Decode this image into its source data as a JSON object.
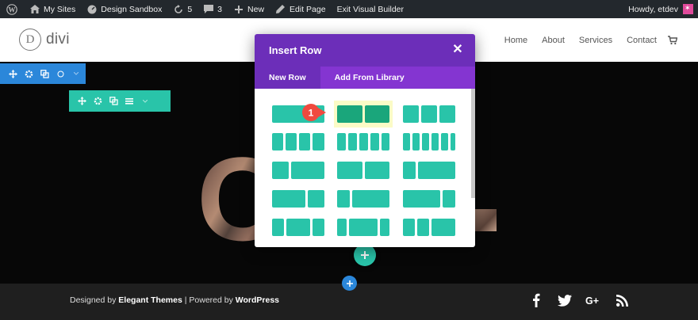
{
  "adminbar": {
    "items": [
      {
        "label": "My Sites"
      },
      {
        "label": "Design Sandbox"
      },
      {
        "label": "5"
      },
      {
        "label": "3"
      },
      {
        "label": "New"
      },
      {
        "label": "Edit Page"
      },
      {
        "label": "Exit Visual Builder"
      }
    ],
    "greeting": "Howdy, etdev"
  },
  "site": {
    "logo_letter": "D",
    "logo_text": "divi",
    "nav": [
      "Home",
      "About",
      "Services",
      "Contact"
    ]
  },
  "modal": {
    "title": "Insert Row",
    "close": "✕",
    "tabs": [
      "New Row",
      "Add From Library"
    ],
    "active_tab": "New Row"
  },
  "layouts": [
    {
      "row": 0,
      "col": 0,
      "fractions": [
        1
      ]
    },
    {
      "row": 0,
      "col": 1,
      "fractions": [
        0.5,
        0.5
      ],
      "highlighted": true
    },
    {
      "row": 0,
      "col": 2,
      "fractions": [
        0.3333,
        0.3333,
        0.3333
      ]
    },
    {
      "row": 1,
      "col": 0,
      "fractions": [
        0.25,
        0.25,
        0.25,
        0.25
      ]
    },
    {
      "row": 1,
      "col": 1,
      "fractions": [
        0.2,
        0.2,
        0.2,
        0.2,
        0.2
      ]
    },
    {
      "row": 1,
      "col": 2,
      "fractions": [
        0.1667,
        0.1667,
        0.1667,
        0.1667,
        0.1667,
        0.1667
      ]
    },
    {
      "row": 2,
      "col": 0,
      "fractions": [
        0.3333,
        0.6667
      ]
    },
    {
      "row": 2,
      "col": 1,
      "fractions": [
        0.5,
        0.5
      ]
    },
    {
      "row": 2,
      "col": 2,
      "fractions": [
        0.25,
        0.75
      ]
    },
    {
      "row": 3,
      "col": 0,
      "fractions": [
        0.6667,
        0.3333
      ]
    },
    {
      "row": 3,
      "col": 1,
      "fractions": [
        0.25,
        0.75
      ]
    },
    {
      "row": 3,
      "col": 2,
      "fractions": [
        0.75,
        0.25
      ]
    },
    {
      "row": 4,
      "col": 0,
      "fractions": [
        0.25,
        0.5,
        0.25
      ]
    },
    {
      "row": 4,
      "col": 1,
      "fractions": [
        0.2,
        0.6,
        0.2
      ]
    },
    {
      "row": 4,
      "col": 2,
      "fractions": [
        0.25,
        0.25,
        0.5
      ]
    }
  ],
  "badge": {
    "label": "1",
    "color": "#f04a3f"
  },
  "hero": {
    "text": "C"
  },
  "footer": {
    "designed_by": "Designed by",
    "elegant": "Elegant Themes",
    "separator": " | Powered by ",
    "wordpress": "WordPress",
    "social_icons": [
      "facebook-icon",
      "twitter-icon",
      "google-plus-icon",
      "rss-icon"
    ]
  },
  "colors": {
    "purple": "#6c2eb9",
    "purple_light": "#8435d1",
    "teal": "#29c4a9",
    "teal_dark": "#1aa67b",
    "blue": "#2b87da",
    "highlight_bg": "#fbfbc6"
  }
}
